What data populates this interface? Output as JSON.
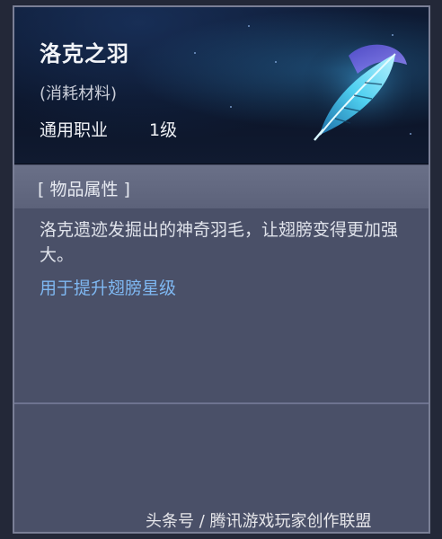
{
  "item": {
    "name": "洛克之羽",
    "type": "(消耗材料)",
    "class": "通用职业",
    "level": "1级",
    "icon": "feather-icon"
  },
  "properties": {
    "section_title": "[ 物品属性 ]",
    "description": "洛克遗迹发掘出的神奇羽毛，让翅膀变得更加强大。",
    "usage": "用于提升翅膀星级"
  },
  "watermark": "头条号 / 腾讯游戏玩家创作联盟",
  "colors": {
    "panel": "#4a5068",
    "header_bg": "#0e1a33",
    "usage_text": "#7fb8f2"
  }
}
